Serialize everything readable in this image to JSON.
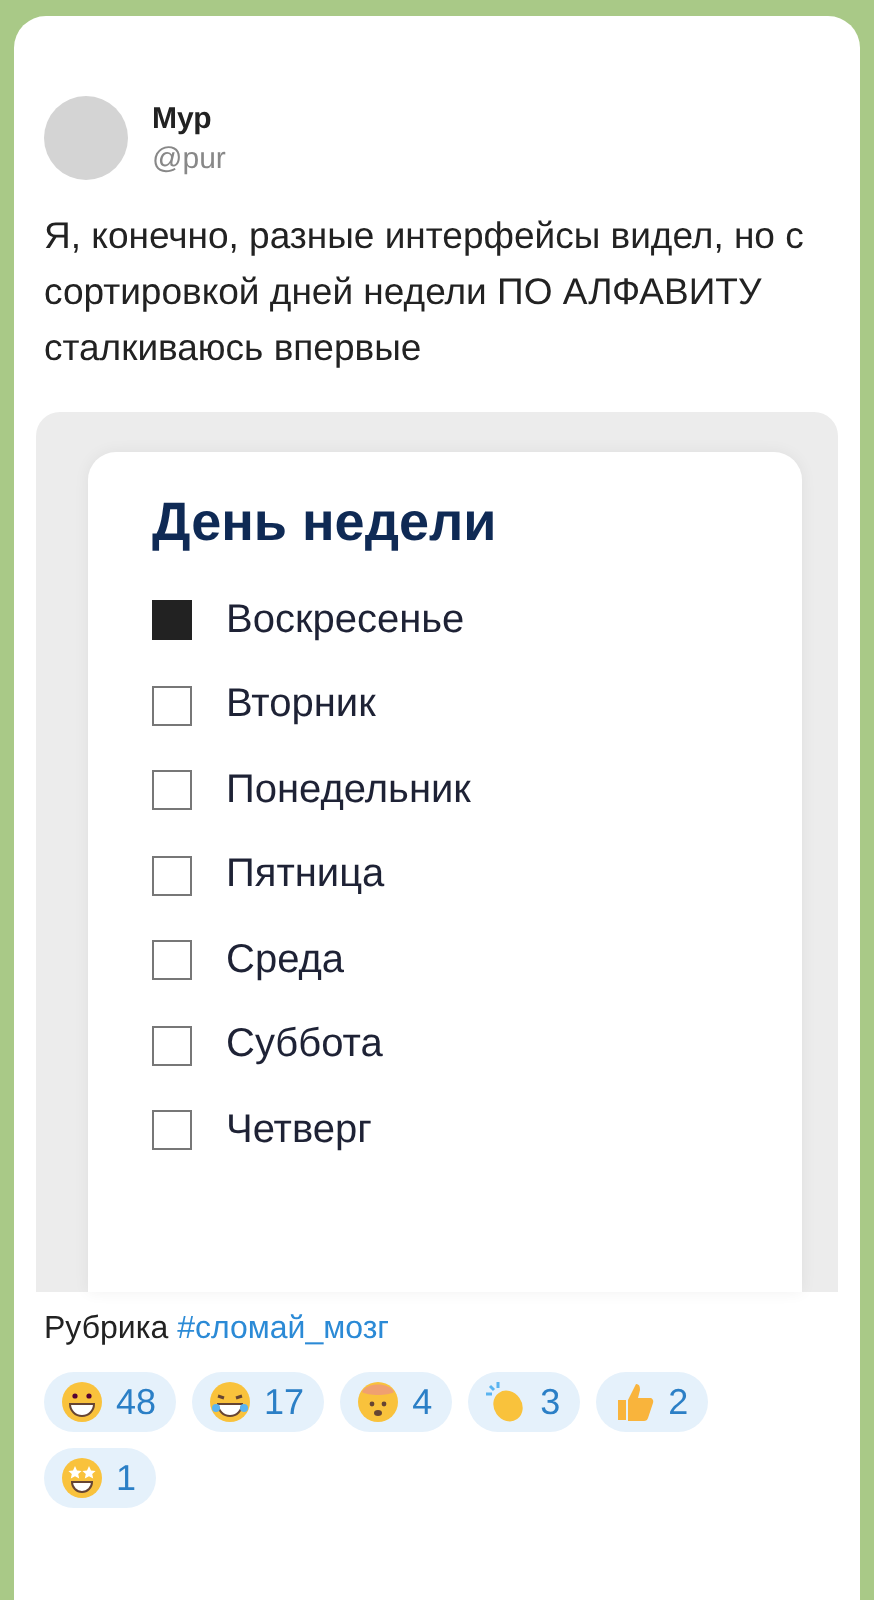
{
  "post": {
    "author": "Мур",
    "handle": "@pur",
    "text": "Я, конечно, разные интерфейсы видел, но с сортировкой дней недели ПО АЛФАВИТУ сталкиваюсь впервые"
  },
  "filter": {
    "title": "День недели",
    "options": [
      {
        "label": "Воскресенье",
        "checked": true
      },
      {
        "label": "Вторник",
        "checked": false
      },
      {
        "label": "Понедельник",
        "checked": false
      },
      {
        "label": "Пятница",
        "checked": false
      },
      {
        "label": "Среда",
        "checked": false
      },
      {
        "label": "Суббота",
        "checked": false
      },
      {
        "label": "Четверг",
        "checked": false
      }
    ]
  },
  "caption": {
    "text": "Рубрика",
    "hashtag": "#сломай_мозг"
  },
  "reactions": [
    {
      "count": "48"
    },
    {
      "count": "17"
    },
    {
      "count": "4"
    },
    {
      "count": "3"
    },
    {
      "count": "2"
    },
    {
      "count": "1"
    }
  ]
}
